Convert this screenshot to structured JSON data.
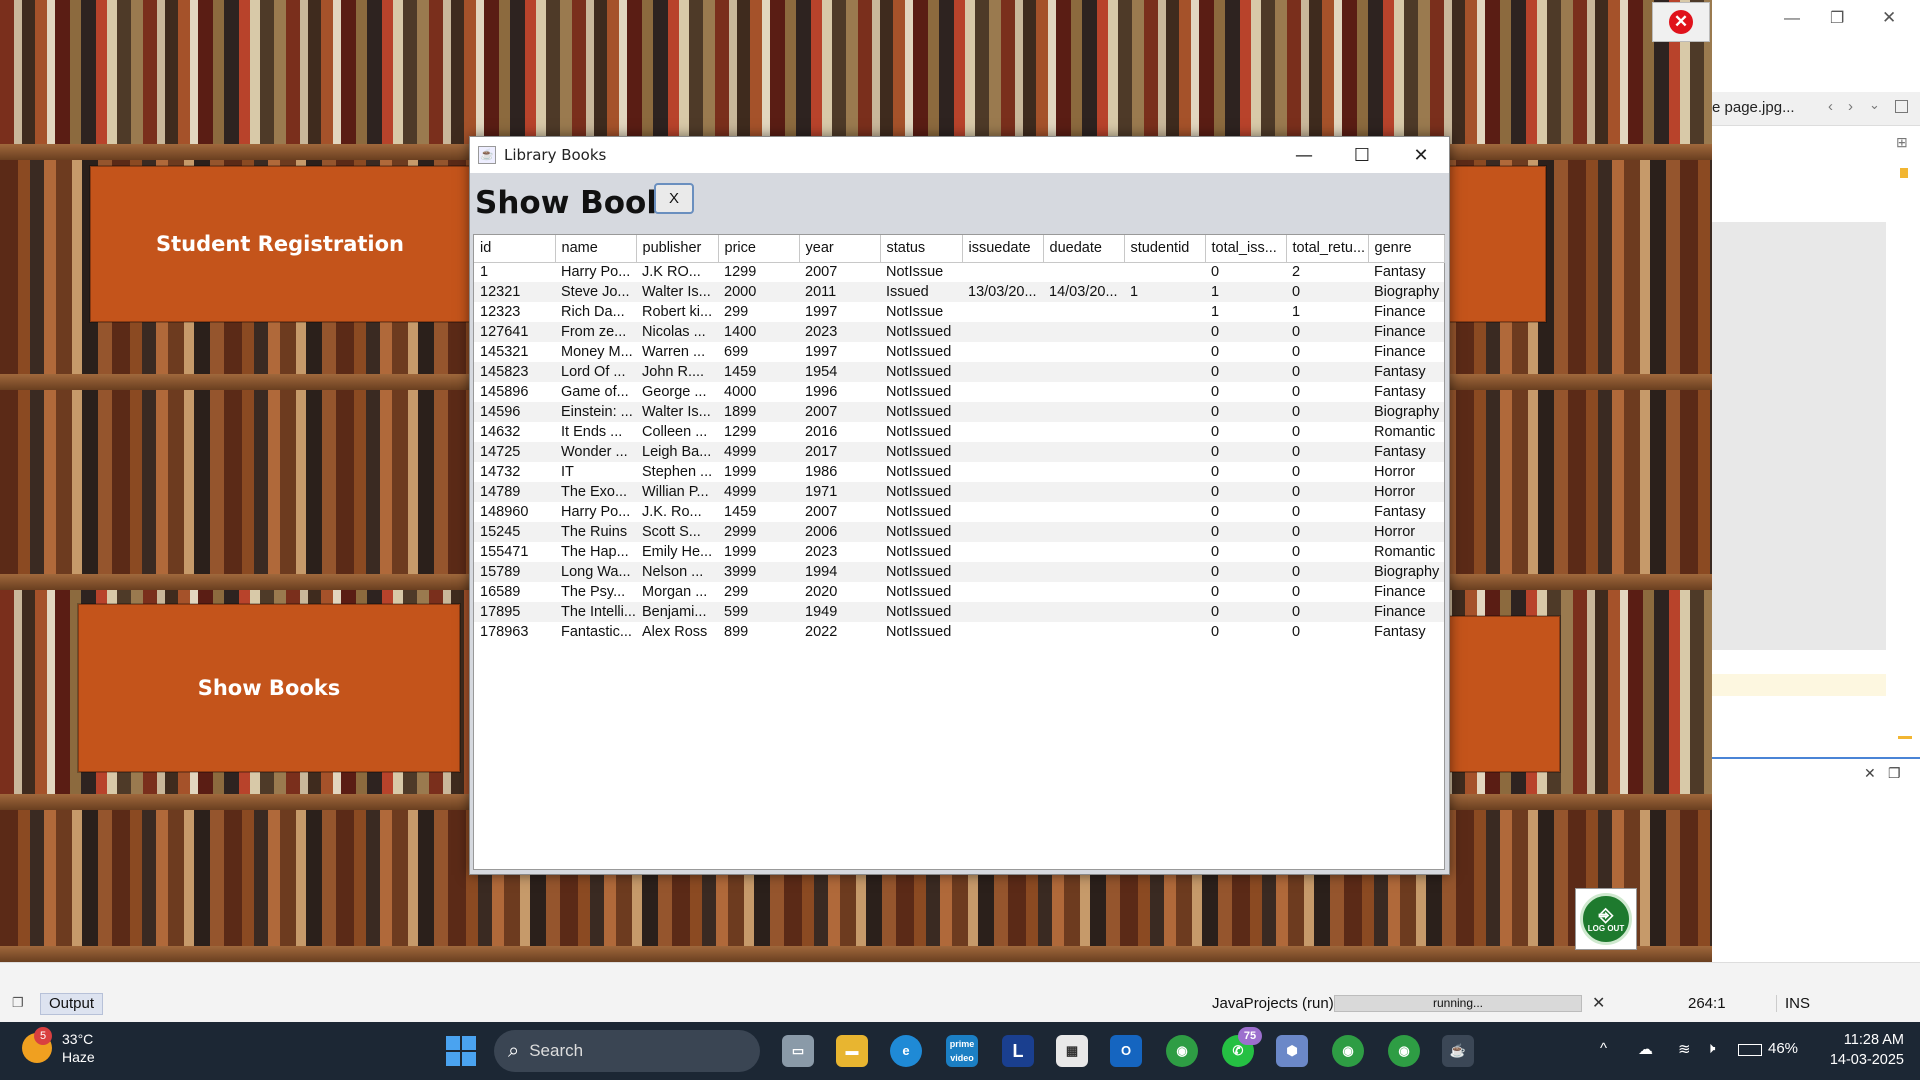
{
  "panels": {
    "student_registration": "Student Registration",
    "show_books": "Show Books"
  },
  "ide": {
    "tab_title": "e page.jpg...",
    "output_tab": "Output",
    "project": "JavaProjects (run)",
    "progress_text": "running...",
    "position": "264:1",
    "mode": "INS"
  },
  "window": {
    "title": "Library Books",
    "heading": "Show Books",
    "close_label": "X",
    "minimize_glyph": "—",
    "maximize_glyph": "☐",
    "close_glyph": "✕"
  },
  "table": {
    "columns": [
      "id",
      "name",
      "publisher",
      "price",
      "year",
      "status",
      "issuedate",
      "duedate",
      "studentid",
      "total_iss...",
      "total_retu...",
      "genre"
    ],
    "rows": [
      [
        "1",
        "Harry Po...",
        "J.K RO...",
        "1299",
        "2007",
        "NotIssue",
        "",
        "",
        "",
        "0",
        "2",
        "Fantasy"
      ],
      [
        "12321",
        "Steve Jo...",
        "Walter Is...",
        "2000",
        "2011",
        "Issued",
        "13/03/20...",
        "14/03/20...",
        "1",
        "1",
        "0",
        "Biography"
      ],
      [
        "12323",
        "Rich Da...",
        "Robert ki...",
        "299",
        "1997",
        "NotIssue",
        "",
        "",
        "",
        "1",
        "1",
        "Finance"
      ],
      [
        "127641",
        "From ze...",
        "Nicolas ...",
        "1400",
        "2023",
        "NotIssued",
        "",
        "",
        "",
        "0",
        "0",
        "Finance"
      ],
      [
        "145321",
        "Money M...",
        "Warren ...",
        "699",
        "1997",
        "NotIssued",
        "",
        "",
        "",
        "0",
        "0",
        "Finance"
      ],
      [
        "145823",
        "Lord Of ...",
        "John R....",
        "1459",
        "1954",
        "NotIssued",
        "",
        "",
        "",
        "0",
        "0",
        "Fantasy"
      ],
      [
        "145896",
        "Game of...",
        "George ...",
        "4000",
        "1996",
        "NotIssued",
        "",
        "",
        "",
        "0",
        "0",
        "Fantasy"
      ],
      [
        "14596",
        "Einstein: ...",
        "Walter Is...",
        "1899",
        "2007",
        "NotIssued",
        "",
        "",
        "",
        "0",
        "0",
        "Biography"
      ],
      [
        "14632",
        "It Ends ...",
        "Colleen ...",
        "1299",
        "2016",
        "NotIssued",
        "",
        "",
        "",
        "0",
        "0",
        "Romantic"
      ],
      [
        "14725",
        "Wonder ...",
        "Leigh Ba...",
        "4999",
        "2017",
        "NotIssued",
        "",
        "",
        "",
        "0",
        "0",
        "Fantasy"
      ],
      [
        "14732",
        "IT",
        "Stephen ...",
        "1999",
        "1986",
        "NotIssued",
        "",
        "",
        "",
        "0",
        "0",
        "Horror"
      ],
      [
        "14789",
        "The Exo...",
        "Willian P...",
        "4999",
        "1971",
        "NotIssued",
        "",
        "",
        "",
        "0",
        "0",
        "Horror"
      ],
      [
        "148960",
        "Harry Po...",
        "J.K. Ro...",
        "1459",
        "2007",
        "NotIssued",
        "",
        "",
        "",
        "0",
        "0",
        "Fantasy"
      ],
      [
        "15245",
        "The Ruins",
        "Scott S...",
        "2999",
        "2006",
        "NotIssued",
        "",
        "",
        "",
        "0",
        "0",
        "Horror"
      ],
      [
        "155471",
        "The Hap...",
        "Emily He...",
        "1999",
        "2023",
        "NotIssued",
        "",
        "",
        "",
        "0",
        "0",
        "Romantic"
      ],
      [
        "15789",
        "Long Wa...",
        "Nelson ...",
        "3999",
        "1994",
        "NotIssued",
        "",
        "",
        "",
        "0",
        "0",
        "Biography"
      ],
      [
        "16589",
        "The Psy...",
        "Morgan ...",
        "299",
        "2020",
        "NotIssued",
        "",
        "",
        "",
        "0",
        "0",
        "Finance"
      ],
      [
        "17895",
        "The Intelli...",
        "Benjami...",
        "599",
        "1949",
        "NotIssued",
        "",
        "",
        "",
        "0",
        "0",
        "Finance"
      ],
      [
        "178963",
        "Fantastic...",
        "Alex Ross",
        "899",
        "2022",
        "NotIssued",
        "",
        "",
        "",
        "0",
        "0",
        "Fantasy"
      ]
    ]
  },
  "logout": {
    "label": "LOG OUT"
  },
  "taskbar": {
    "temperature": "33°C",
    "condition": "Haze",
    "weather_badge": "5",
    "search_label": "Search",
    "whatsapp_badge": "75",
    "battery": "46%",
    "time": "11:28 AM",
    "date": "14-03-2025"
  },
  "colors": {
    "panel": "#c4541b",
    "window_body": "#d6d9df",
    "taskbar": "#1c2734"
  }
}
